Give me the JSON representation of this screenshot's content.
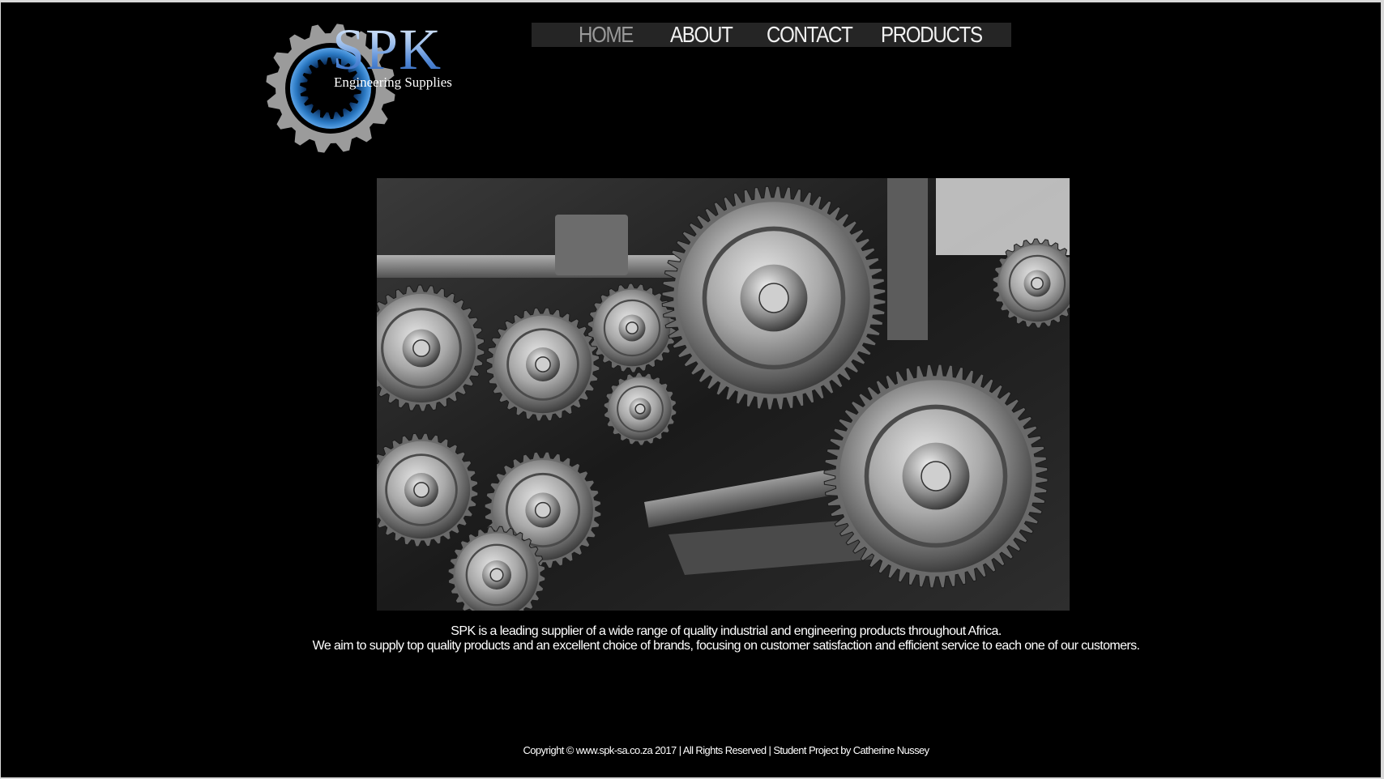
{
  "logo": {
    "title": "SPK",
    "subtitle": "Engineering Supplies",
    "colors": {
      "gear": "#9b9b9b",
      "ring": "#2a78c2",
      "title": "#6f9ee2"
    }
  },
  "nav": {
    "items": [
      {
        "label": "HOME",
        "active": true
      },
      {
        "label": "ABOUT",
        "active": false
      },
      {
        "label": "CONTACT",
        "active": false
      },
      {
        "label": "PRODUCTS",
        "active": false
      }
    ]
  },
  "hero": {
    "image_subject": "industrial-gears-photo"
  },
  "intro": {
    "line1": "SPK is a leading supplier of a wide range of quality industrial and engineering products throughout Africa.",
    "line2": "We aim to supply top quality products and an excellent choice of brands, focusing on customer satisfaction and efficient service to each one of our customers."
  },
  "footer": {
    "text": "Copyright © www.spk-sa.co.za 2017 | All Rights Reserved | Student Project by Catherine Nussey"
  }
}
